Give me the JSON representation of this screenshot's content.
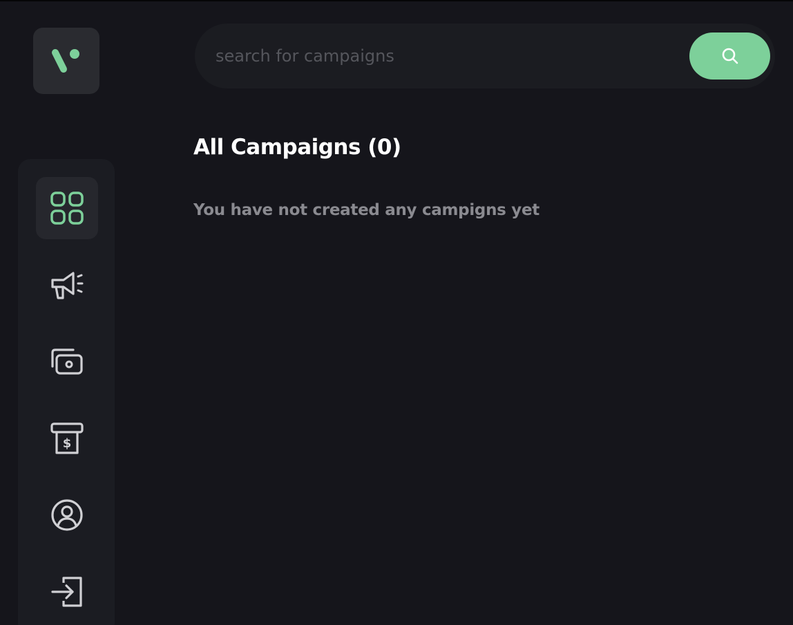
{
  "search": {
    "placeholder": "search for campaigns"
  },
  "main": {
    "title": "All Campaigns (0)",
    "empty_message": "You have not created any campigns yet"
  },
  "sidebar": {
    "items": [
      {
        "icon": "dashboard-grid-icon",
        "active": true
      },
      {
        "icon": "megaphone-icon",
        "active": false
      },
      {
        "icon": "money-icon",
        "active": false
      },
      {
        "icon": "receipt-dollar-icon",
        "active": false
      },
      {
        "icon": "user-profile-icon",
        "active": false
      },
      {
        "icon": "sign-in-icon",
        "active": false
      }
    ]
  },
  "colors": {
    "accent": "#7dd09a",
    "background": "#15151b",
    "surface": "#1b1c22",
    "icon": "#d0d0d4"
  }
}
